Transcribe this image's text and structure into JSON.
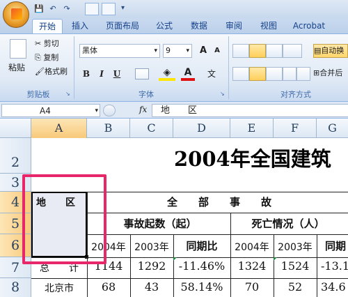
{
  "quick_access": {
    "save": "💾",
    "undo": "↶",
    "redo": "↷"
  },
  "tabs": [
    "开始",
    "插入",
    "页面布局",
    "公式",
    "数据",
    "审阅",
    "视图",
    "Acrobat"
  ],
  "clipboard": {
    "paste": "粘贴",
    "cut": "剪切",
    "copy": "复制",
    "format_painter": "格式刷",
    "group": "剪贴板"
  },
  "font": {
    "name": "黑体",
    "size": "9",
    "grow": "A",
    "shrink": "A",
    "bold": "B",
    "italic": "I",
    "underline": "U",
    "wen": "文",
    "group": "字体"
  },
  "alignment": {
    "wrap": "自动换",
    "merge": "合并后",
    "group": "对齐方式"
  },
  "formula_bar": {
    "name_box": "A4",
    "fx": "fx",
    "content": "地　　区"
  },
  "columns": [
    "A",
    "B",
    "C",
    "D",
    "E",
    "F",
    "G"
  ],
  "rows": [
    "2",
    "3",
    "4",
    "5",
    "6",
    "7",
    "8"
  ],
  "sheet": {
    "title": "2004年全国建筑",
    "a4": "地　　区",
    "all_accidents": "全　　部　　事　　故",
    "accident_count": "事故起数（起）",
    "death_status": "死亡情况（人）",
    "year_2004": "2004年",
    "year_2003": "2003年",
    "yoy": "同期比",
    "yoy_partial": "同期",
    "year_2004_e": "2004年",
    "year_2003_f": "2003年",
    "row7": {
      "label": "总　　计",
      "b": "1144",
      "c": "1292",
      "d": "-11.46%",
      "e": "1324",
      "f": "1524",
      "g": "-13.1"
    },
    "row8": {
      "label": "北京市",
      "b": "68",
      "c": "43",
      "d": "58.14%",
      "e": "70",
      "f": "52",
      "g": "34.6"
    }
  },
  "colors": {
    "highlight": "#e8266a",
    "ribbon": "#dfe9f5",
    "tab_text": "#15428b"
  }
}
